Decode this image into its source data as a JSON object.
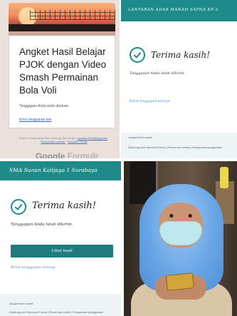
{
  "panel_form": {
    "title": "Angket Hasil Belajar PJOK dengan Video Smash Permainan Bola Voli",
    "response_note": "Tanggapan Anda telah direkam.",
    "edit_link": "Kirim tanggapan lain",
    "footer_line1": "Konten ini tidak dibuat atau didukung oleh Google.",
    "footer_link1": "Laporkan Penyalahgunaan",
    "footer_link2": "Persyaratan Layanan",
    "footer_link3": "Kebijakan Privasi",
    "logo_brand": "Google",
    "logo_product": "Formulir",
    "colors": {
      "banner_stripe": "#c9a79a",
      "background": "#eae0dc"
    }
  },
  "panel_thanks_top": {
    "header": "LANTARAN ADAB MANAH SAPNA KE-2",
    "check_icon": "check-circle-icon",
    "thanks": "Terima kasih!",
    "response": "Tanggapan Anda telah dikirim.",
    "link": "Kirim tanggapan lainnya",
    "never": "Jangan kirim sandi",
    "created": "Didukung oleh Microsoft Forms | Privasi dan cookie | Persyaratan penggunaan",
    "colors": {
      "accent": "#1f8a8a"
    }
  },
  "panel_thanks_bottom": {
    "header": "SMA Sunan Kalijaga 1 Surabaya",
    "check_icon": "check-circle-icon",
    "thanks": "Terima kasih!",
    "response": "Tanggapan Anda telah dikirim.",
    "button": "Lihat hasil",
    "link": "Kirim tanggapan lainnya",
    "never": "Jangan kirim sandi",
    "created": "Didukung oleh Microsoft Forms | Privasi dan cookie | Persyaratan penggunaan",
    "colors": {
      "accent": "#1f8a8a",
      "button": "#1f7d7f"
    }
  }
}
